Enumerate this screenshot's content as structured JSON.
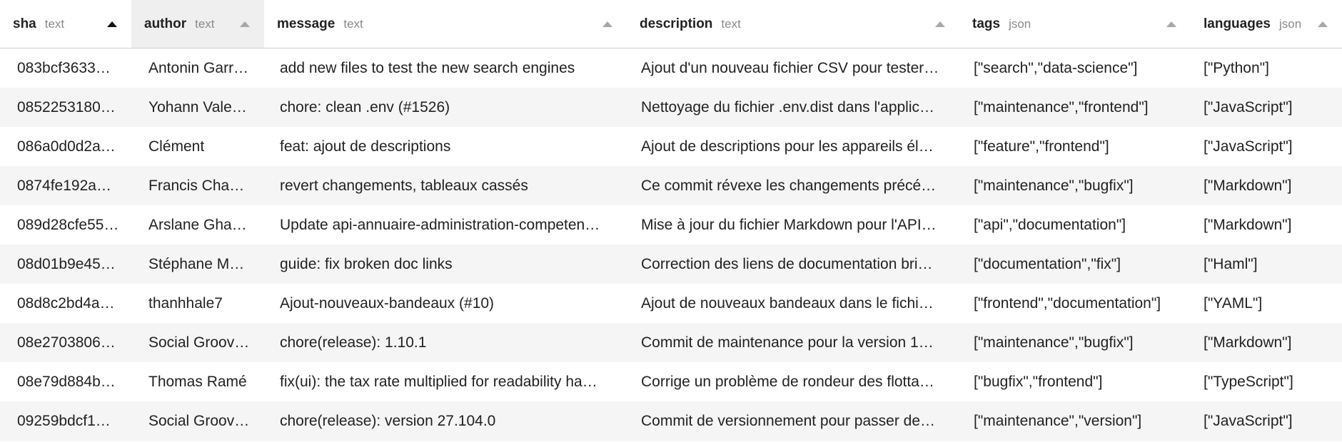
{
  "columns": [
    {
      "name": "sha",
      "type": "text",
      "sort": "ascending-active"
    },
    {
      "name": "author",
      "type": "text",
      "sort": "ascending"
    },
    {
      "name": "message",
      "type": "text",
      "sort": "ascending"
    },
    {
      "name": "description",
      "type": "text",
      "sort": "ascending"
    },
    {
      "name": "tags",
      "type": "json",
      "sort": "ascending"
    },
    {
      "name": "languages",
      "type": "json",
      "sort": "ascending"
    }
  ],
  "rows": [
    {
      "sha": "083bcf3633…",
      "author": "Antonin Garr…",
      "message": "add new files to test the new search engines",
      "description": "Ajout d'un nouveau fichier CSV pour tester…",
      "tags": "[\"search\",\"data-science\"]",
      "languages": "[\"Python\"]"
    },
    {
      "sha": "0852253180…",
      "author": "Yohann Vale…",
      "message": "chore: clean .env (#1526)",
      "description": "Nettoyage du fichier .env.dist dans l'applic…",
      "tags": "[\"maintenance\",\"frontend\"]",
      "languages": "[\"JavaScript\"]"
    },
    {
      "sha": "086a0d0d2a…",
      "author": "Clément",
      "message": "feat: ajout de descriptions",
      "description": "Ajout de descriptions pour les appareils él…",
      "tags": "[\"feature\",\"frontend\"]",
      "languages": "[\"JavaScript\"]"
    },
    {
      "sha": "0874fe192a…",
      "author": "Francis Chab…",
      "message": "revert changements, tableaux cassés",
      "description": "Ce commit révexe les changements précé…",
      "tags": "[\"maintenance\",\"bugfix\"]",
      "languages": "[\"Markdown\"]"
    },
    {
      "sha": "089d28cfe55…",
      "author": "Arslane Ghar…",
      "message": "Update api-annuaire-administration-competen…",
      "description": "Mise à jour du fichier Markdown pour l'API…",
      "tags": "[\"api\",\"documentation\"]",
      "languages": "[\"Markdown\"]"
    },
    {
      "sha": "08d01b9e45…",
      "author": "Stéphane M…",
      "message": "guide: fix broken doc links",
      "description": "Correction des liens de documentation bri…",
      "tags": "[\"documentation\",\"fix\"]",
      "languages": "[\"Haml\"]"
    },
    {
      "sha": "08d8c2bd4a…",
      "author": "thanhhale7",
      "message": "Ajout-nouveaux-bandeaux (#10)",
      "description": "Ajout de nouveaux bandeaux dans le fichi…",
      "tags": "[\"frontend\",\"documentation\"]",
      "languages": "[\"YAML\"]"
    },
    {
      "sha": "08e2703806…",
      "author": "Social Groov…",
      "message": "chore(release): 1.10.1",
      "description": "Commit de maintenance pour la version 1…",
      "tags": "[\"maintenance\",\"bugfix\"]",
      "languages": "[\"Markdown\"]"
    },
    {
      "sha": "08e79d884b…",
      "author": "Thomas Ramé",
      "message": "fix(ui): the tax rate multiplied for readability ha…",
      "description": "Corrige un problème de rondeur des flotta…",
      "tags": "[\"bugfix\",\"frontend\"]",
      "languages": "[\"TypeScript\"]"
    },
    {
      "sha": "09259bdcf1…",
      "author": "Social Groov…",
      "message": "chore(release): version 27.104.0",
      "description": "Commit de versionnement pour passer de…",
      "tags": "[\"maintenance\",\"version\"]",
      "languages": "[\"JavaScript\"]"
    }
  ]
}
